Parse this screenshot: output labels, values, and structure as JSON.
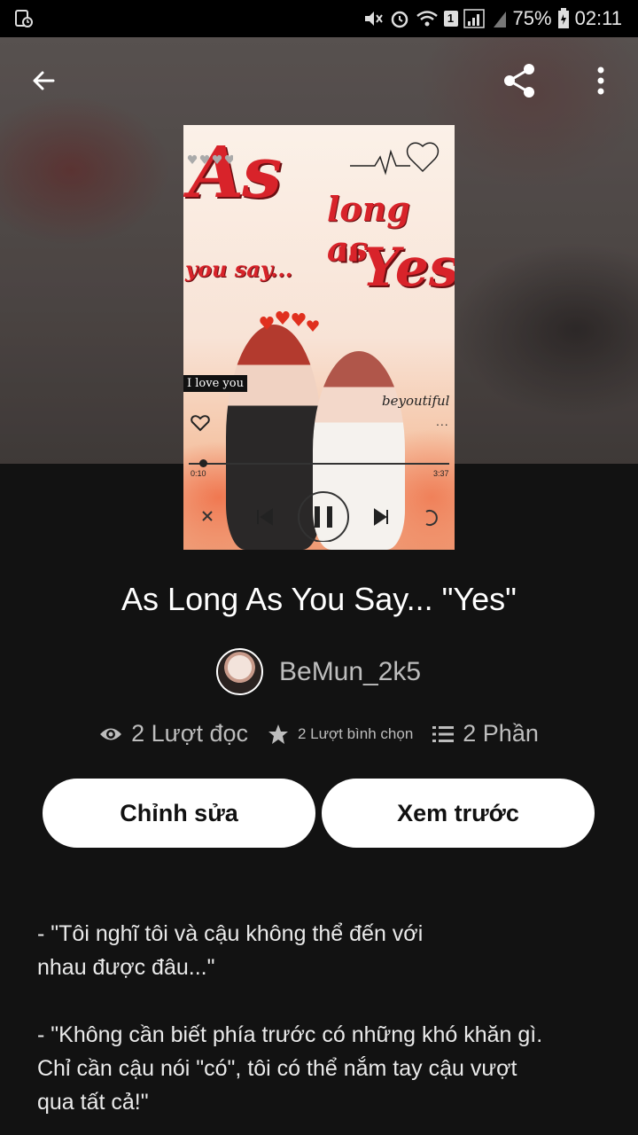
{
  "status_bar": {
    "battery": "75%",
    "time": "02:11",
    "sim": "1"
  },
  "book": {
    "title": "As Long As You Say... \"Yes\"",
    "author": "BeMun_2k5",
    "cover": {
      "line1": "As",
      "line2": "long as",
      "line3": "you say...",
      "line4": "\"Yes\"",
      "caption_left": "I love you",
      "caption_right": "beyoutiful",
      "time_start": "0:10",
      "time_end": "3:37"
    }
  },
  "stats": {
    "reads": "2 Lượt đọc",
    "votes": "2 Lượt bình chọn",
    "parts": "2 Phần"
  },
  "actions": {
    "edit_label": "Chỉnh sửa",
    "preview_label": "Xem trước"
  },
  "description": {
    "para1": "- \"Tôi nghĩ tôi và cậu không thể đến với nhau được đâu...\"",
    "para2": "- \"Không cần biết phía trước có những khó khăn gì. Chỉ cần cậu nói \"có\", tôi có thể nắm tay cậu vượt qua tất cả!\""
  },
  "icons": [
    "back-arrow-icon",
    "share-icon",
    "more-vertical-icon",
    "eye-icon",
    "star-icon",
    "list-icon"
  ]
}
